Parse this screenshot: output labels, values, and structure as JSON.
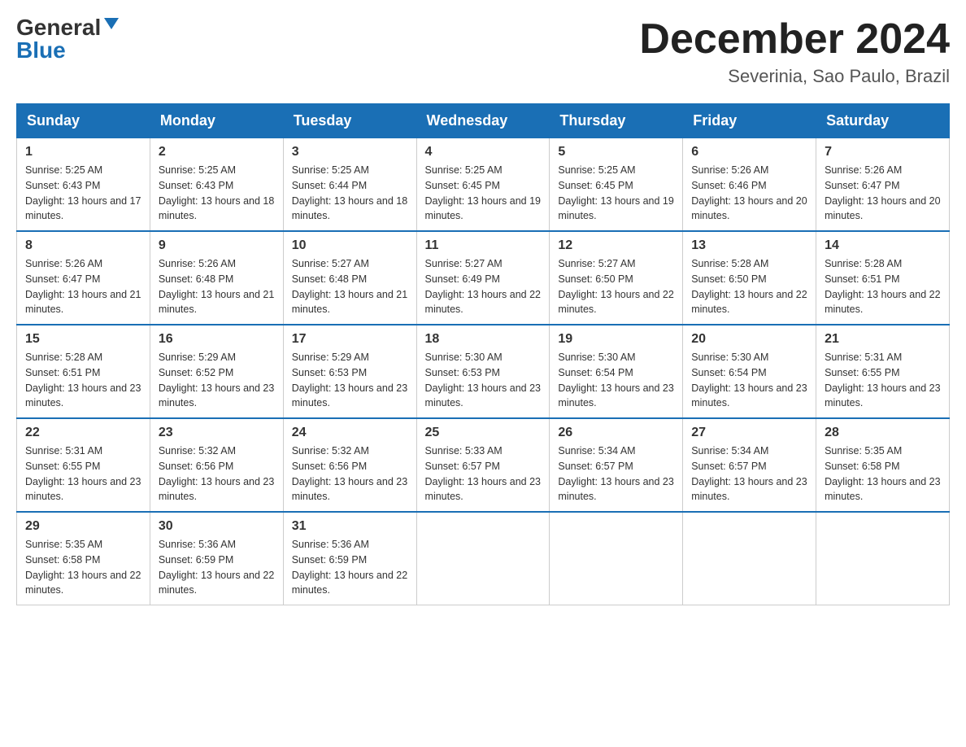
{
  "header": {
    "logo_general": "General",
    "logo_blue": "Blue",
    "month_title": "December 2024",
    "location": "Severinia, Sao Paulo, Brazil"
  },
  "days_of_week": [
    "Sunday",
    "Monday",
    "Tuesday",
    "Wednesday",
    "Thursday",
    "Friday",
    "Saturday"
  ],
  "weeks": [
    [
      {
        "day": "1",
        "sunrise": "5:25 AM",
        "sunset": "6:43 PM",
        "daylight": "13 hours and 17 minutes."
      },
      {
        "day": "2",
        "sunrise": "5:25 AM",
        "sunset": "6:43 PM",
        "daylight": "13 hours and 18 minutes."
      },
      {
        "day": "3",
        "sunrise": "5:25 AM",
        "sunset": "6:44 PM",
        "daylight": "13 hours and 18 minutes."
      },
      {
        "day": "4",
        "sunrise": "5:25 AM",
        "sunset": "6:45 PM",
        "daylight": "13 hours and 19 minutes."
      },
      {
        "day": "5",
        "sunrise": "5:25 AM",
        "sunset": "6:45 PM",
        "daylight": "13 hours and 19 minutes."
      },
      {
        "day": "6",
        "sunrise": "5:26 AM",
        "sunset": "6:46 PM",
        "daylight": "13 hours and 20 minutes."
      },
      {
        "day": "7",
        "sunrise": "5:26 AM",
        "sunset": "6:47 PM",
        "daylight": "13 hours and 20 minutes."
      }
    ],
    [
      {
        "day": "8",
        "sunrise": "5:26 AM",
        "sunset": "6:47 PM",
        "daylight": "13 hours and 21 minutes."
      },
      {
        "day": "9",
        "sunrise": "5:26 AM",
        "sunset": "6:48 PM",
        "daylight": "13 hours and 21 minutes."
      },
      {
        "day": "10",
        "sunrise": "5:27 AM",
        "sunset": "6:48 PM",
        "daylight": "13 hours and 21 minutes."
      },
      {
        "day": "11",
        "sunrise": "5:27 AM",
        "sunset": "6:49 PM",
        "daylight": "13 hours and 22 minutes."
      },
      {
        "day": "12",
        "sunrise": "5:27 AM",
        "sunset": "6:50 PM",
        "daylight": "13 hours and 22 minutes."
      },
      {
        "day": "13",
        "sunrise": "5:28 AM",
        "sunset": "6:50 PM",
        "daylight": "13 hours and 22 minutes."
      },
      {
        "day": "14",
        "sunrise": "5:28 AM",
        "sunset": "6:51 PM",
        "daylight": "13 hours and 22 minutes."
      }
    ],
    [
      {
        "day": "15",
        "sunrise": "5:28 AM",
        "sunset": "6:51 PM",
        "daylight": "13 hours and 23 minutes."
      },
      {
        "day": "16",
        "sunrise": "5:29 AM",
        "sunset": "6:52 PM",
        "daylight": "13 hours and 23 minutes."
      },
      {
        "day": "17",
        "sunrise": "5:29 AM",
        "sunset": "6:53 PM",
        "daylight": "13 hours and 23 minutes."
      },
      {
        "day": "18",
        "sunrise": "5:30 AM",
        "sunset": "6:53 PM",
        "daylight": "13 hours and 23 minutes."
      },
      {
        "day": "19",
        "sunrise": "5:30 AM",
        "sunset": "6:54 PM",
        "daylight": "13 hours and 23 minutes."
      },
      {
        "day": "20",
        "sunrise": "5:30 AM",
        "sunset": "6:54 PM",
        "daylight": "13 hours and 23 minutes."
      },
      {
        "day": "21",
        "sunrise": "5:31 AM",
        "sunset": "6:55 PM",
        "daylight": "13 hours and 23 minutes."
      }
    ],
    [
      {
        "day": "22",
        "sunrise": "5:31 AM",
        "sunset": "6:55 PM",
        "daylight": "13 hours and 23 minutes."
      },
      {
        "day": "23",
        "sunrise": "5:32 AM",
        "sunset": "6:56 PM",
        "daylight": "13 hours and 23 minutes."
      },
      {
        "day": "24",
        "sunrise": "5:32 AM",
        "sunset": "6:56 PM",
        "daylight": "13 hours and 23 minutes."
      },
      {
        "day": "25",
        "sunrise": "5:33 AM",
        "sunset": "6:57 PM",
        "daylight": "13 hours and 23 minutes."
      },
      {
        "day": "26",
        "sunrise": "5:34 AM",
        "sunset": "6:57 PM",
        "daylight": "13 hours and 23 minutes."
      },
      {
        "day": "27",
        "sunrise": "5:34 AM",
        "sunset": "6:57 PM",
        "daylight": "13 hours and 23 minutes."
      },
      {
        "day": "28",
        "sunrise": "5:35 AM",
        "sunset": "6:58 PM",
        "daylight": "13 hours and 23 minutes."
      }
    ],
    [
      {
        "day": "29",
        "sunrise": "5:35 AM",
        "sunset": "6:58 PM",
        "daylight": "13 hours and 22 minutes."
      },
      {
        "day": "30",
        "sunrise": "5:36 AM",
        "sunset": "6:59 PM",
        "daylight": "13 hours and 22 minutes."
      },
      {
        "day": "31",
        "sunrise": "5:36 AM",
        "sunset": "6:59 PM",
        "daylight": "13 hours and 22 minutes."
      },
      null,
      null,
      null,
      null
    ]
  ]
}
